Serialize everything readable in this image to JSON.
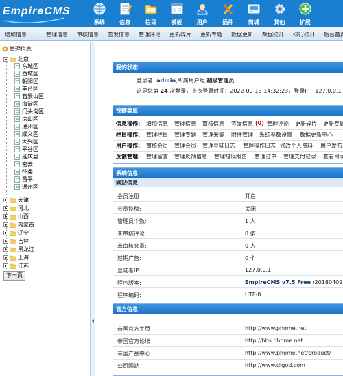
{
  "brand": {
    "logo_text": "EmpireCMS"
  },
  "topnav": [
    {
      "label": "系统",
      "icon": "globe-icon"
    },
    {
      "label": "信息",
      "icon": "document-edit-icon"
    },
    {
      "label": "栏目",
      "icon": "folder-icon"
    },
    {
      "label": "模板",
      "icon": "template-icon"
    },
    {
      "label": "用户",
      "icon": "user-icon"
    },
    {
      "label": "插件",
      "icon": "tools-icon"
    },
    {
      "label": "商城",
      "icon": "shop-icon"
    },
    {
      "label": "其他",
      "icon": "gear-icon"
    },
    {
      "label": "扩展",
      "icon": "plus-icon"
    }
  ],
  "subbar": [
    "增加信息",
    "管理信息",
    "审核信息",
    "签发信息",
    "管理评论",
    "更新碎片",
    "更新专题",
    "数据更新",
    "数据统计",
    "排行统计",
    "后台首页"
  ],
  "tree": {
    "root": "管理信息",
    "expanded": "北京",
    "children": [
      "东城区",
      "西城区",
      "朝阳区",
      "丰台区",
      "石景山区",
      "海淀区",
      "门头沟区",
      "房山区",
      "通州区",
      "顺义区",
      "大兴区",
      "平谷区",
      "延庆县",
      "密云",
      "怀柔",
      "昌平",
      "通州区"
    ],
    "collapsed": [
      "天津",
      "河北",
      "山西",
      "内蒙古",
      "辽宁",
      "吉林",
      "黑龙江",
      "上海",
      "江苏"
    ],
    "next_page": "下一页"
  },
  "status": {
    "title": "我的状态",
    "line1_prefix": "登录者:",
    "user": "admin",
    "line1_mid": ",所属用户组:",
    "group": "超级管理员",
    "line2_prefix": "这是您第",
    "count": "24",
    "line2_mid": "次登录，上次登录时间：",
    "last_time": "2022-09-13 14:32:23",
    "line2_ip_label": "，登录IP：",
    "ip": "127.0.0.1"
  },
  "quick": {
    "title": "快捷菜单",
    "rows": [
      {
        "label": "信息操作:",
        "links": [
          "增加信息",
          "管理信息",
          "审核信息",
          "签发信息",
          "(0)",
          "管理评论",
          "更新碎片",
          "更新专题"
        ]
      },
      {
        "label": "栏目操作:",
        "links": [
          "管理栏目",
          "管理专题",
          "管理采集",
          "附件管理",
          "系统参数设置",
          "数据更新中心"
        ]
      },
      {
        "label": "用户操作:",
        "links": [
          "审核会员",
          "管理会员",
          "管理登陆日志",
          "管理操作日志",
          "修改个人资料",
          "用户发布"
        ]
      },
      {
        "label": "反馈管理:",
        "links": [
          "管理留言",
          "管理反馈信息",
          "管理错误报告",
          "管理订单",
          "管理支付记录",
          "查看目录权"
        ]
      }
    ]
  },
  "sysinfo": {
    "title": "系统信息",
    "subhead": "网站信息",
    "rows": [
      {
        "key": "会员注册:",
        "value": "开启"
      },
      {
        "key": "会员投稿:",
        "value": "关闭"
      },
      {
        "key": "管理员个数:",
        "value": "1 人"
      },
      {
        "key": "未审核评论:",
        "value": "0 条"
      },
      {
        "key": "未审核会员:",
        "value": "0 人"
      },
      {
        "key": "过期广告:",
        "value": "0 个"
      },
      {
        "key": "登陆者IP:",
        "value": "127.0.0.1"
      },
      {
        "key": "程序版本:",
        "value": "EmpireCMS v7.5 Free",
        "extra": "(201804091030)"
      },
      {
        "key": "程序编码:",
        "value": "UTF-8"
      }
    ]
  },
  "official": {
    "title": "官方信息",
    "rows": [
      {
        "key": "帝国官方主页",
        "value": "http://www.phome.net"
      },
      {
        "key": "帝国官方论坛",
        "value": "http://bbs.phome.net"
      },
      {
        "key": "帝国产品中心",
        "value": "http://www.phome.net/product/"
      },
      {
        "key": "公司网站",
        "value": "http://www.digod.com"
      }
    ]
  },
  "colors": {
    "header_blue": "#1a7fd1",
    "panel_title": "#2a84d6",
    "subhead_bg": "#dde9f6",
    "accent_red": "#cc0000"
  }
}
